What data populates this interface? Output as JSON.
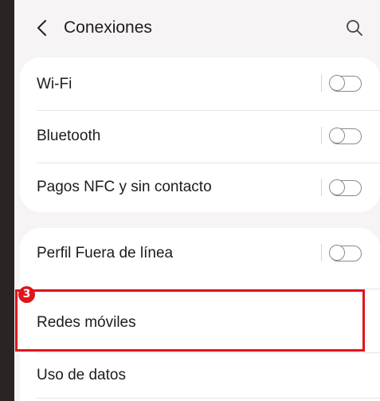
{
  "header": {
    "title": "Conexiones",
    "back_icon": "chevron-left-icon",
    "search_icon": "search-icon"
  },
  "settings_group_1": [
    {
      "label": "Wi-Fi",
      "toggle_on": false
    },
    {
      "label": "Bluetooth",
      "toggle_on": false
    },
    {
      "label": "Pagos NFC y sin contacto",
      "toggle_on": false
    }
  ],
  "settings_group_2": [
    {
      "label": "Perfil Fuera de línea",
      "toggle_on": false
    },
    {
      "label": "Redes móviles"
    },
    {
      "label": "Uso de datos"
    }
  ],
  "annotation": {
    "step_number": "3",
    "color": "#e2141b"
  }
}
